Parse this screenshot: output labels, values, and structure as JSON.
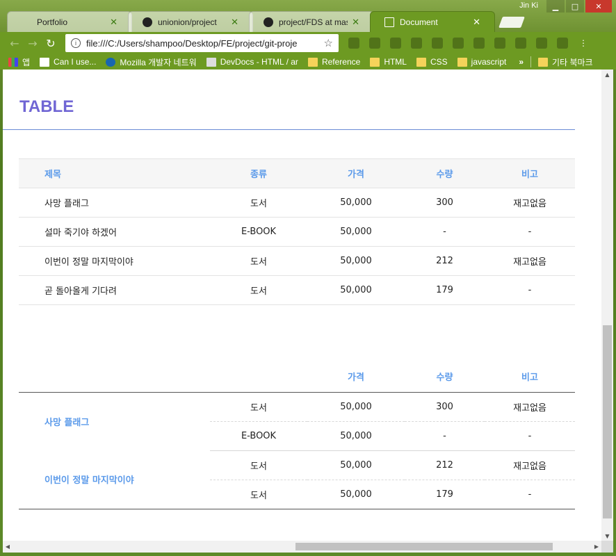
{
  "window": {
    "user": "Jin Ki",
    "min": "▁",
    "max": "□",
    "close": "✕"
  },
  "tabs": [
    {
      "label": "Portfolio",
      "icon": "none",
      "active": false
    },
    {
      "label": "unionion/project",
      "icon": "github-icon",
      "active": false
    },
    {
      "label": "project/FDS at maste",
      "icon": "github-icon",
      "active": false
    },
    {
      "label": "Document",
      "icon": "document-icon",
      "active": true
    }
  ],
  "tab_close": "✕",
  "toolbar": {
    "back": "←",
    "forward": "→",
    "reload": "↻",
    "url": "file:///C:/Users/shampoo/Desktop/FE/project/git-proje",
    "info": "i",
    "star": "☆",
    "menu": "⋮"
  },
  "bookmarks": [
    {
      "label": "앱",
      "icon": "apps-icon"
    },
    {
      "label": "Can I use...",
      "icon": "caniuse-icon"
    },
    {
      "label": "Mozilla 개발자 네트워",
      "icon": "mdn-icon"
    },
    {
      "label": "DevDocs - HTML / ar",
      "icon": "devdocs-icon"
    },
    {
      "label": "Reference",
      "icon": "folder-icon"
    },
    {
      "label": "HTML",
      "icon": "folder-icon"
    },
    {
      "label": "CSS",
      "icon": "folder-icon"
    },
    {
      "label": "javascript",
      "icon": "folder-icon"
    }
  ],
  "bookmarks_more": "»",
  "bookmarks_other": "기타 북마크",
  "page": {
    "title": "TABLE",
    "table1": {
      "headers": [
        "제목",
        "종류",
        "가격",
        "수량",
        "비고"
      ],
      "rows": [
        [
          "사망 플래그",
          "도서",
          "50,000",
          "300",
          "재고없음"
        ],
        [
          "설마 죽기야 하겠어",
          "E-BOOK",
          "50,000",
          "-",
          "-"
        ],
        [
          "이번이 정말 마지막이야",
          "도서",
          "50,000",
          "212",
          "재고없음"
        ],
        [
          "곧 돌아올게 기다려",
          "도서",
          "50,000",
          "179",
          "-"
        ]
      ]
    },
    "table2": {
      "headers": [
        "",
        "",
        "가격",
        "수량",
        "비고"
      ],
      "groups": [
        {
          "title": "사망 플래그",
          "rows": [
            [
              "도서",
              "50,000",
              "300",
              "재고없음"
            ],
            [
              "E-BOOK",
              "50,000",
              "-",
              "-"
            ]
          ]
        },
        {
          "title": "이번이 정말 마지막이야",
          "rows": [
            [
              "도서",
              "50,000",
              "212",
              "재고없음"
            ],
            [
              "도서",
              "50,000",
              "179",
              "-"
            ]
          ]
        }
      ]
    }
  },
  "colors": {
    "title": "#7066d4",
    "header_text": "#5b9aea",
    "rule": "#6a8ad6"
  }
}
